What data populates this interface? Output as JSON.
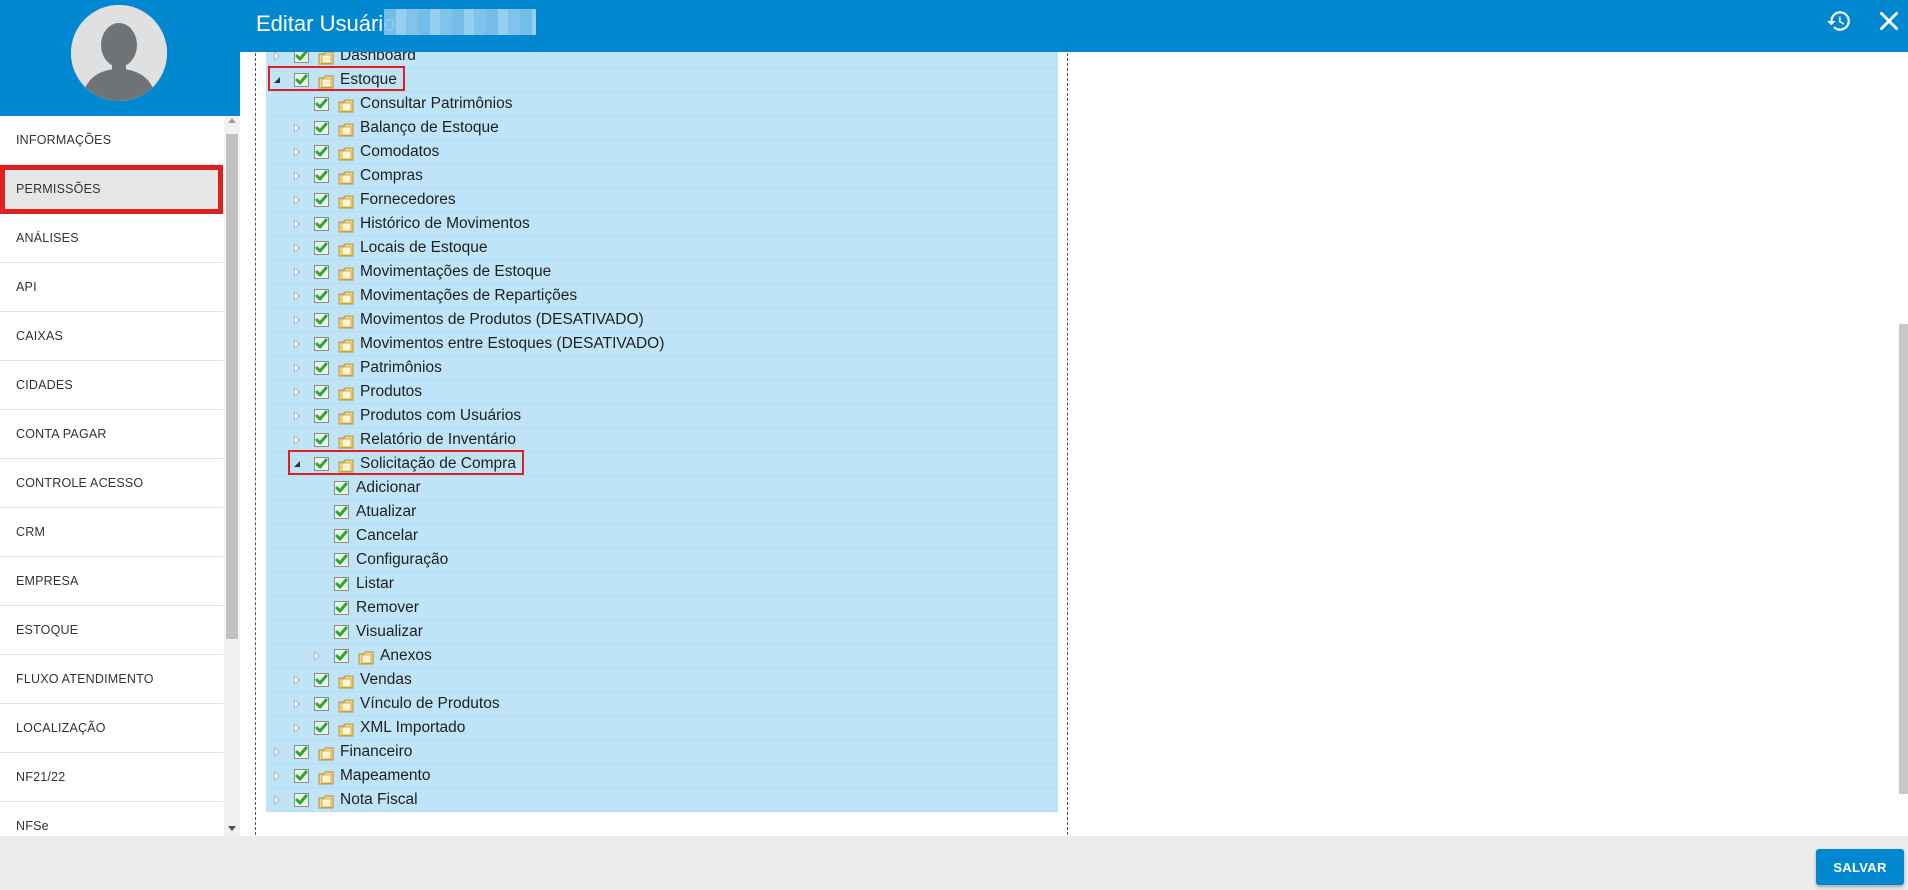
{
  "header": {
    "title": "Editar Usuário",
    "history_icon": "history-icon",
    "close_icon": "close-icon",
    "color": "#0288d1"
  },
  "sidebar": {
    "items": [
      {
        "label": "INFORMAÇÕES",
        "active": false
      },
      {
        "label": "PERMISSÕES",
        "active": true
      },
      {
        "label": "ANÁLISES",
        "active": false
      },
      {
        "label": "API",
        "active": false
      },
      {
        "label": "CAIXAS",
        "active": false
      },
      {
        "label": "CIDADES",
        "active": false
      },
      {
        "label": "CONTA PAGAR",
        "active": false
      },
      {
        "label": "CONTROLE ACESSO",
        "active": false
      },
      {
        "label": "CRM",
        "active": false
      },
      {
        "label": "EMPRESA",
        "active": false
      },
      {
        "label": "ESTOQUE",
        "active": false
      },
      {
        "label": "FLUXO ATENDIMENTO",
        "active": false
      },
      {
        "label": "LOCALIZAÇÃO",
        "active": false
      },
      {
        "label": "NF21/22",
        "active": false
      },
      {
        "label": "NFSe",
        "active": false
      }
    ]
  },
  "tree": {
    "rows": [
      {
        "label": "Dashboard",
        "level": 0,
        "state": "collapsed",
        "folder": true,
        "highlight": false
      },
      {
        "label": "Estoque",
        "level": 0,
        "state": "expanded",
        "folder": true,
        "highlight": true
      },
      {
        "label": "Consultar Patrimônios",
        "level": 1,
        "state": "leaf",
        "folder": true,
        "highlight": false
      },
      {
        "label": "Balanço de Estoque",
        "level": 1,
        "state": "collapsed",
        "folder": true,
        "highlight": false
      },
      {
        "label": "Comodatos",
        "level": 1,
        "state": "collapsed",
        "folder": true,
        "highlight": false
      },
      {
        "label": "Compras",
        "level": 1,
        "state": "collapsed",
        "folder": true,
        "highlight": false
      },
      {
        "label": "Fornecedores",
        "level": 1,
        "state": "collapsed",
        "folder": true,
        "highlight": false
      },
      {
        "label": "Histórico de Movimentos",
        "level": 1,
        "state": "collapsed",
        "folder": true,
        "highlight": false
      },
      {
        "label": "Locais de Estoque",
        "level": 1,
        "state": "collapsed",
        "folder": true,
        "highlight": false
      },
      {
        "label": "Movimentações de Estoque",
        "level": 1,
        "state": "collapsed",
        "folder": true,
        "highlight": false
      },
      {
        "label": "Movimentações de Repartições",
        "level": 1,
        "state": "collapsed",
        "folder": true,
        "highlight": false
      },
      {
        "label": "Movimentos de Produtos (DESATIVADO)",
        "level": 1,
        "state": "collapsed",
        "folder": true,
        "highlight": false
      },
      {
        "label": "Movimentos entre Estoques (DESATIVADO)",
        "level": 1,
        "state": "collapsed",
        "folder": true,
        "highlight": false
      },
      {
        "label": "Patrimônios",
        "level": 1,
        "state": "collapsed",
        "folder": true,
        "highlight": false
      },
      {
        "label": "Produtos",
        "level": 1,
        "state": "collapsed",
        "folder": true,
        "highlight": false
      },
      {
        "label": "Produtos com Usuários",
        "level": 1,
        "state": "collapsed",
        "folder": true,
        "highlight": false
      },
      {
        "label": "Relatório de Inventário",
        "level": 1,
        "state": "collapsed",
        "folder": true,
        "highlight": false
      },
      {
        "label": "Solicitação de Compra",
        "level": 1,
        "state": "expanded",
        "folder": true,
        "highlight": true
      },
      {
        "label": "Adicionar",
        "level": 2,
        "state": "leaf",
        "folder": false,
        "highlight": false
      },
      {
        "label": "Atualizar",
        "level": 2,
        "state": "leaf",
        "folder": false,
        "highlight": false
      },
      {
        "label": "Cancelar",
        "level": 2,
        "state": "leaf",
        "folder": false,
        "highlight": false
      },
      {
        "label": "Configuração",
        "level": 2,
        "state": "leaf",
        "folder": false,
        "highlight": false
      },
      {
        "label": "Listar",
        "level": 2,
        "state": "leaf",
        "folder": false,
        "highlight": false
      },
      {
        "label": "Remover",
        "level": 2,
        "state": "leaf",
        "folder": false,
        "highlight": false
      },
      {
        "label": "Visualizar",
        "level": 2,
        "state": "leaf",
        "folder": false,
        "highlight": false
      },
      {
        "label": "Anexos",
        "level": 2,
        "state": "collapsed",
        "folder": true,
        "highlight": false
      },
      {
        "label": "Vendas",
        "level": 1,
        "state": "collapsed",
        "folder": true,
        "highlight": false
      },
      {
        "label": "Vínculo de Produtos",
        "level": 1,
        "state": "collapsed",
        "folder": true,
        "highlight": false
      },
      {
        "label": "XML Importado",
        "level": 1,
        "state": "collapsed",
        "folder": true,
        "highlight": false
      },
      {
        "label": "Financeiro",
        "level": 0,
        "state": "collapsed",
        "folder": true,
        "highlight": false
      },
      {
        "label": "Mapeamento",
        "level": 0,
        "state": "collapsed",
        "folder": true,
        "highlight": false
      },
      {
        "label": "Nota Fiscal",
        "level": 0,
        "state": "collapsed",
        "folder": true,
        "highlight": false
      }
    ],
    "row_color": "#bfe4f8",
    "check_color": "#2fa62f",
    "folder_color": "#e8c56a",
    "highlight_color": "#e02020"
  },
  "footer": {
    "save_label": "SALVAR"
  }
}
